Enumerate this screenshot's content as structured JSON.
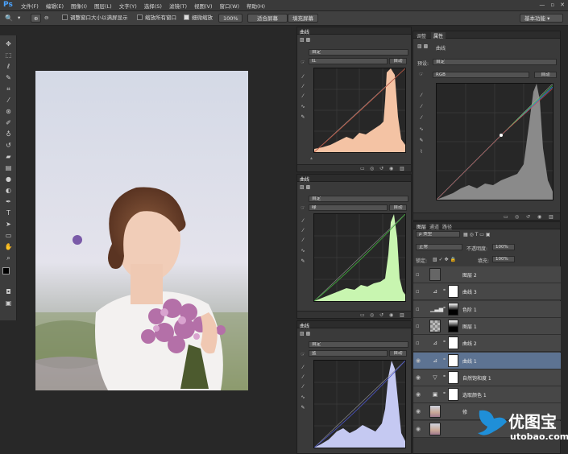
{
  "app": {
    "logo": "Ps"
  },
  "menu": [
    "文件(F)",
    "编辑(E)",
    "图像(I)",
    "图层(L)",
    "文字(Y)",
    "选择(S)",
    "滤镜(T)",
    "视图(V)",
    "窗口(W)",
    "帮助(H)"
  ],
  "window_buttons": [
    "—",
    "▫",
    "✕"
  ],
  "options": {
    "resize_windows": "调整窗口大小以满屏显示",
    "zoom_all": "缩放所有窗口",
    "scrubby_zoom": "细微缩放",
    "zoom_level": "100%",
    "fit_screen": "适合屏幕",
    "fill_screen": "填充屏幕",
    "workspace": "基本功能"
  },
  "curves_panel_1": {
    "tab": "曲线",
    "preset": "自定",
    "channel": "红",
    "auto": "自动",
    "accent": "#f4c3a4",
    "line": "#c0503a"
  },
  "curves_panel_2": {
    "tab": "曲线",
    "preset": "自定",
    "channel": "绿",
    "auto": "自动",
    "accent": "#c8f5b0",
    "line": "#3fae3a"
  },
  "curves_panel_3": {
    "tab": "曲线",
    "preset": "自定",
    "channel": "蓝",
    "auto": "自动",
    "accent": "#c5c9f2",
    "line": "#4b55c8"
  },
  "properties_panel": {
    "tab_adjust": "调整",
    "tab_props": "属性",
    "type": "曲线",
    "preset_label": "预设:",
    "preset": "自定",
    "channel": "RGB",
    "auto": "自动"
  },
  "layers_panel": {
    "tabs": [
      "图层",
      "通道",
      "路径"
    ],
    "kind": "ρ 类型",
    "blend_mode": "正常",
    "opacity_label": "不透明度:",
    "opacity": "100%",
    "lock_label": "锁定:",
    "fill_label": "填充:",
    "fill": "100%",
    "layers": [
      {
        "name": "图层 2",
        "kind": "plain",
        "visible": false,
        "selected": false
      },
      {
        "name": "曲线 3",
        "kind": "curves",
        "visible": false,
        "selected": false
      },
      {
        "name": "色阶 1",
        "kind": "levels",
        "visible": false,
        "selected": false
      },
      {
        "name": "图层 1",
        "kind": "pixel",
        "visible": false,
        "selected": false
      },
      {
        "name": "曲线 2",
        "kind": "curves",
        "visible": false,
        "selected": false
      },
      {
        "name": "曲线 1",
        "kind": "curves",
        "visible": true,
        "selected": true
      },
      {
        "name": "自然饱和度 1",
        "kind": "vibrance",
        "visible": true,
        "selected": false
      },
      {
        "name": "选取颜色 1",
        "kind": "selective",
        "visible": true,
        "selected": false
      },
      {
        "name": "修",
        "kind": "photo",
        "visible": true,
        "selected": false
      },
      {
        "name": "",
        "kind": "photo",
        "visible": true,
        "selected": false
      }
    ]
  },
  "watermark": {
    "brand": "优图宝",
    "url": "utobao.com"
  },
  "colors": {
    "accent_blue": "#4aa3ff",
    "selected_layer": "#5d7392"
  }
}
